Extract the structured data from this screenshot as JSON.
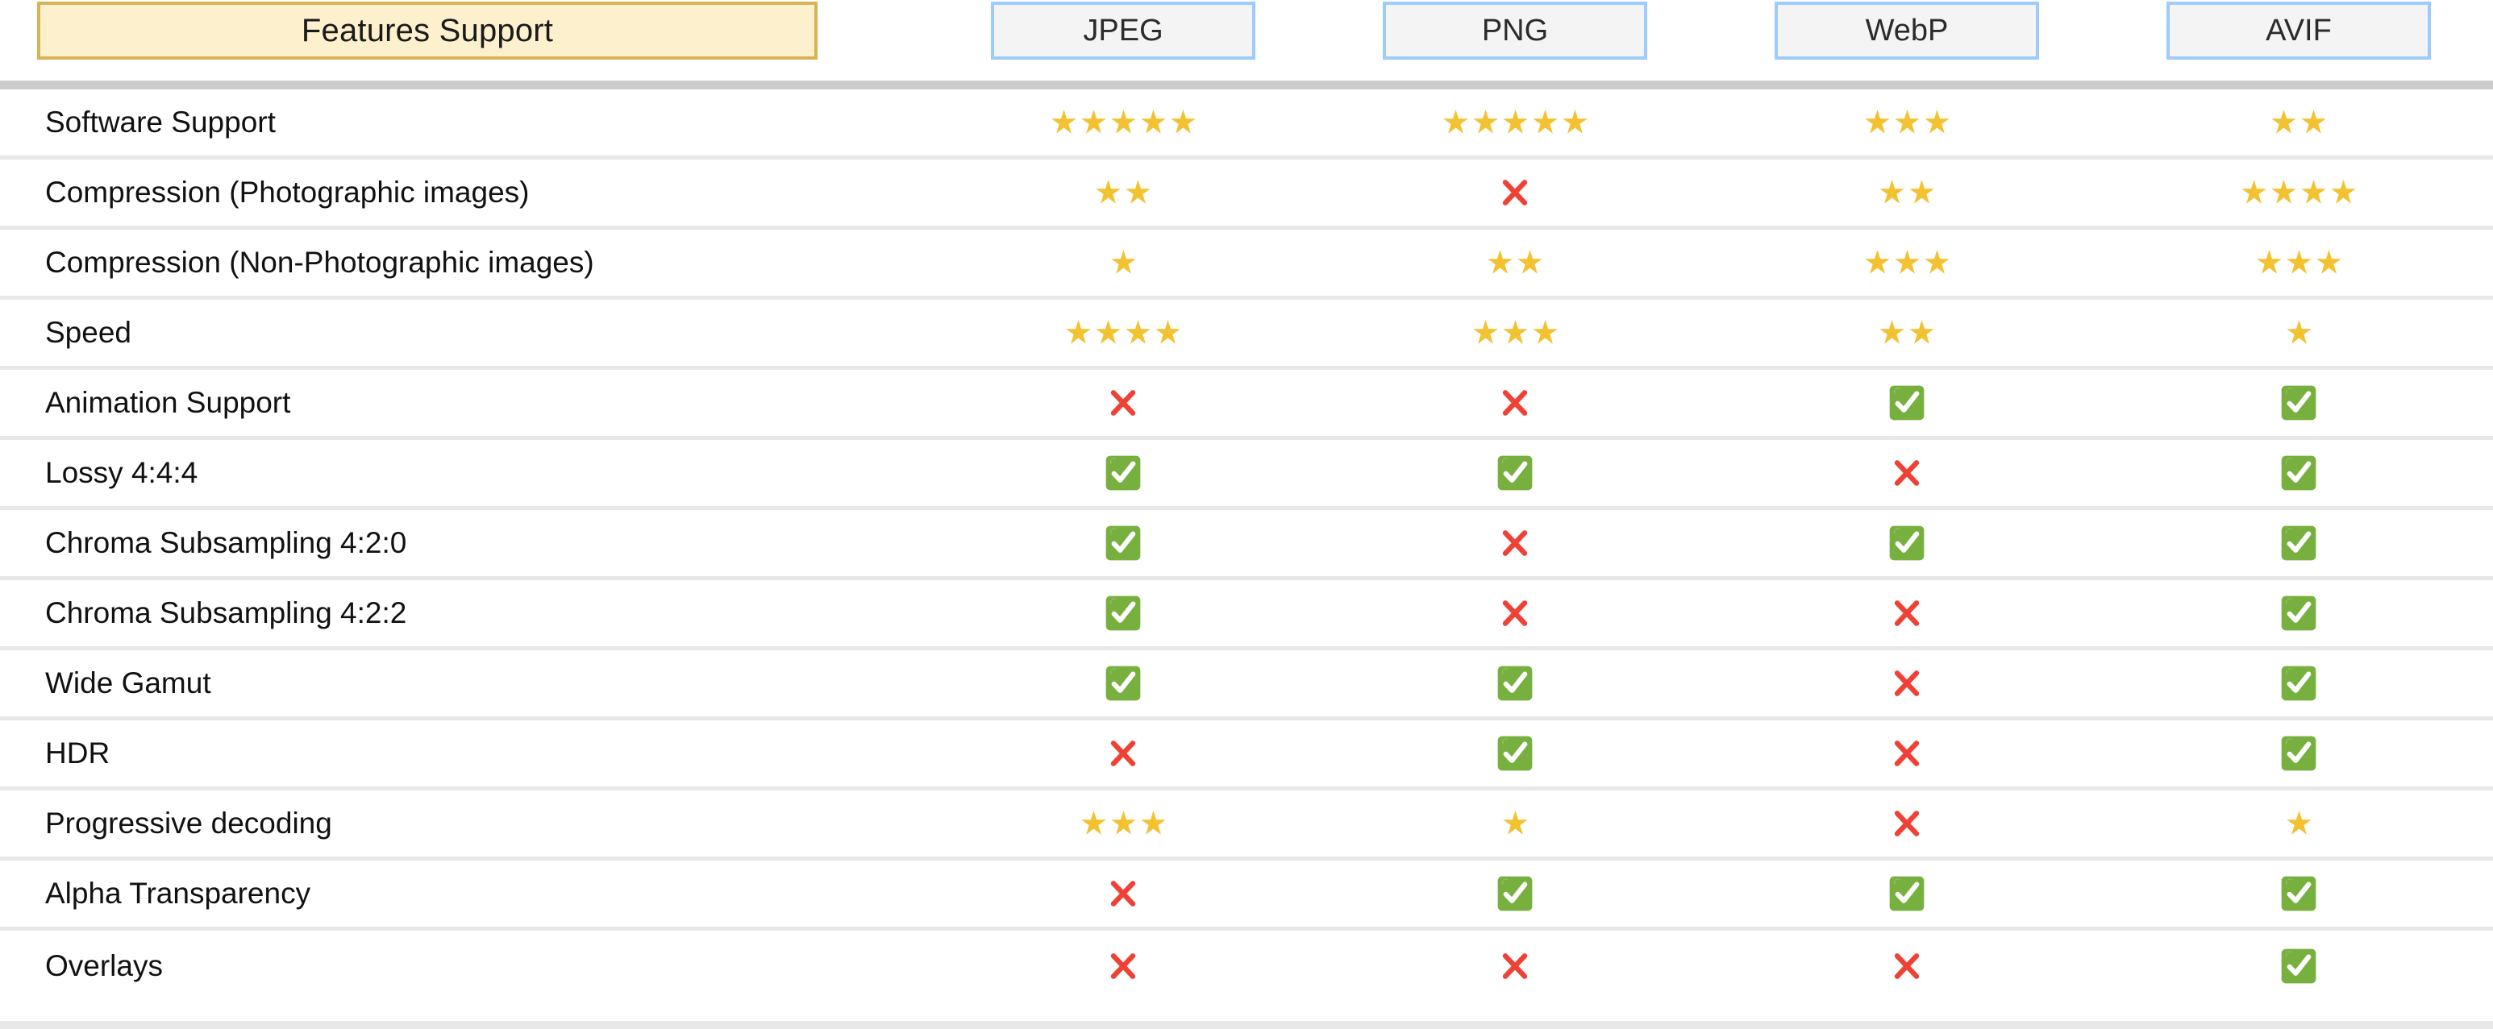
{
  "table": {
    "feature_header_label": "Features Support",
    "format_headers": [
      "JPEG",
      "PNG",
      "WebP",
      "AVIF"
    ],
    "colors": {
      "feature_header_fill": "#fdf0cd",
      "feature_header_border": "#d7b355",
      "format_header_fill": "#f4f4f4",
      "format_header_border": "#9cccfb",
      "star": "#f2c230",
      "check_box": "#78b040",
      "check_mark": "#ffffff",
      "cross": "#ef4136",
      "row_divider": "#e8e8e8",
      "header_rule": "#cccccc"
    },
    "icon_names": {
      "star": "star-icon",
      "check": "check-mark-icon",
      "cross": "cross-mark-icon"
    },
    "rows": [
      {
        "feature": "Software Support",
        "values": [
          {
            "type": "stars",
            "count": 5
          },
          {
            "type": "stars",
            "count": 5
          },
          {
            "type": "stars",
            "count": 3
          },
          {
            "type": "stars",
            "count": 2
          }
        ]
      },
      {
        "feature": "Compression (Photographic images)",
        "values": [
          {
            "type": "stars",
            "count": 2
          },
          {
            "type": "cross",
            "count": 0
          },
          {
            "type": "stars",
            "count": 2
          },
          {
            "type": "stars",
            "count": 4
          }
        ]
      },
      {
        "feature": "Compression (Non-Photographic images)",
        "values": [
          {
            "type": "stars",
            "count": 1
          },
          {
            "type": "stars",
            "count": 2
          },
          {
            "type": "stars",
            "count": 3
          },
          {
            "type": "stars",
            "count": 3
          }
        ]
      },
      {
        "feature": "Speed",
        "values": [
          {
            "type": "stars",
            "count": 4
          },
          {
            "type": "stars",
            "count": 3
          },
          {
            "type": "stars",
            "count": 2
          },
          {
            "type": "stars",
            "count": 1
          }
        ]
      },
      {
        "feature": "Animation Support",
        "values": [
          {
            "type": "cross",
            "count": 0
          },
          {
            "type": "cross",
            "count": 0
          },
          {
            "type": "check",
            "count": 0
          },
          {
            "type": "check",
            "count": 0
          }
        ]
      },
      {
        "feature": "Lossy 4:4:4",
        "values": [
          {
            "type": "check",
            "count": 0
          },
          {
            "type": "check",
            "count": 0
          },
          {
            "type": "cross",
            "count": 0
          },
          {
            "type": "check",
            "count": 0
          }
        ]
      },
      {
        "feature": "Chroma Subsampling 4:2:0",
        "values": [
          {
            "type": "check",
            "count": 0
          },
          {
            "type": "cross",
            "count": 0
          },
          {
            "type": "check",
            "count": 0
          },
          {
            "type": "check",
            "count": 0
          }
        ]
      },
      {
        "feature": "Chroma Subsampling 4:2:2",
        "values": [
          {
            "type": "check",
            "count": 0
          },
          {
            "type": "cross",
            "count": 0
          },
          {
            "type": "cross",
            "count": 0
          },
          {
            "type": "check",
            "count": 0
          }
        ]
      },
      {
        "feature": "Wide Gamut",
        "values": [
          {
            "type": "check",
            "count": 0
          },
          {
            "type": "check",
            "count": 0
          },
          {
            "type": "cross",
            "count": 0
          },
          {
            "type": "check",
            "count": 0
          }
        ]
      },
      {
        "feature": "HDR",
        "values": [
          {
            "type": "cross",
            "count": 0
          },
          {
            "type": "check",
            "count": 0
          },
          {
            "type": "cross",
            "count": 0
          },
          {
            "type": "check",
            "count": 0
          }
        ]
      },
      {
        "feature": "Progressive decoding",
        "values": [
          {
            "type": "stars",
            "count": 3
          },
          {
            "type": "stars",
            "count": 1
          },
          {
            "type": "cross",
            "count": 0
          },
          {
            "type": "stars",
            "count": 1
          }
        ]
      },
      {
        "feature": "Alpha Transparency",
        "values": [
          {
            "type": "cross",
            "count": 0
          },
          {
            "type": "check",
            "count": 0
          },
          {
            "type": "check",
            "count": 0
          },
          {
            "type": "check",
            "count": 0
          }
        ]
      },
      {
        "feature": "Overlays",
        "values": [
          {
            "type": "cross",
            "count": 0
          },
          {
            "type": "cross",
            "count": 0
          },
          {
            "type": "cross",
            "count": 0
          },
          {
            "type": "check",
            "count": 0
          }
        ]
      }
    ]
  }
}
